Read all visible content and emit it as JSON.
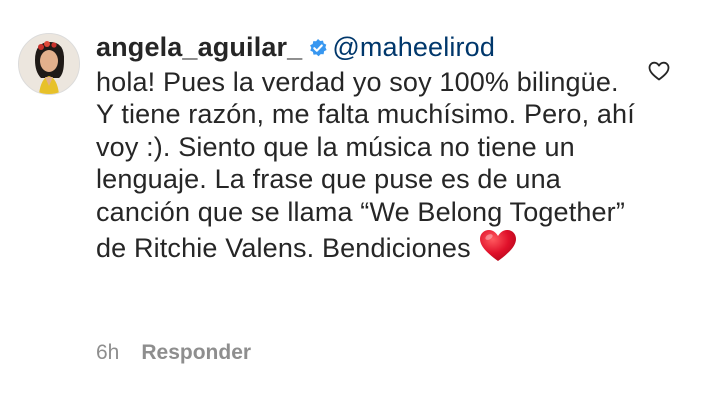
{
  "comment": {
    "username": "angela_aguilar_",
    "verified_icon": "verified-badge-icon",
    "mention": "@maheelirod",
    "text": "hola! Pues la verdad yo soy 100% bilingüe. Y tiene razón, me falta muchísimo. Pero, ahí voy :). Siento que la música no tiene un lenguaje. La frase que puse es de una canción que se llama “We Belong Together” de Ritchie Valens. Bendiciones",
    "emoji_icon": "red-heart-emoji",
    "time": "6h",
    "reply_label": "Responder",
    "like_icon": "heart-outline-icon"
  },
  "colors": {
    "text": "#262626",
    "mention": "#00376b",
    "muted": "#8e8e8e",
    "verified": "#3897f0",
    "heart_emoji": "#e0102a"
  }
}
